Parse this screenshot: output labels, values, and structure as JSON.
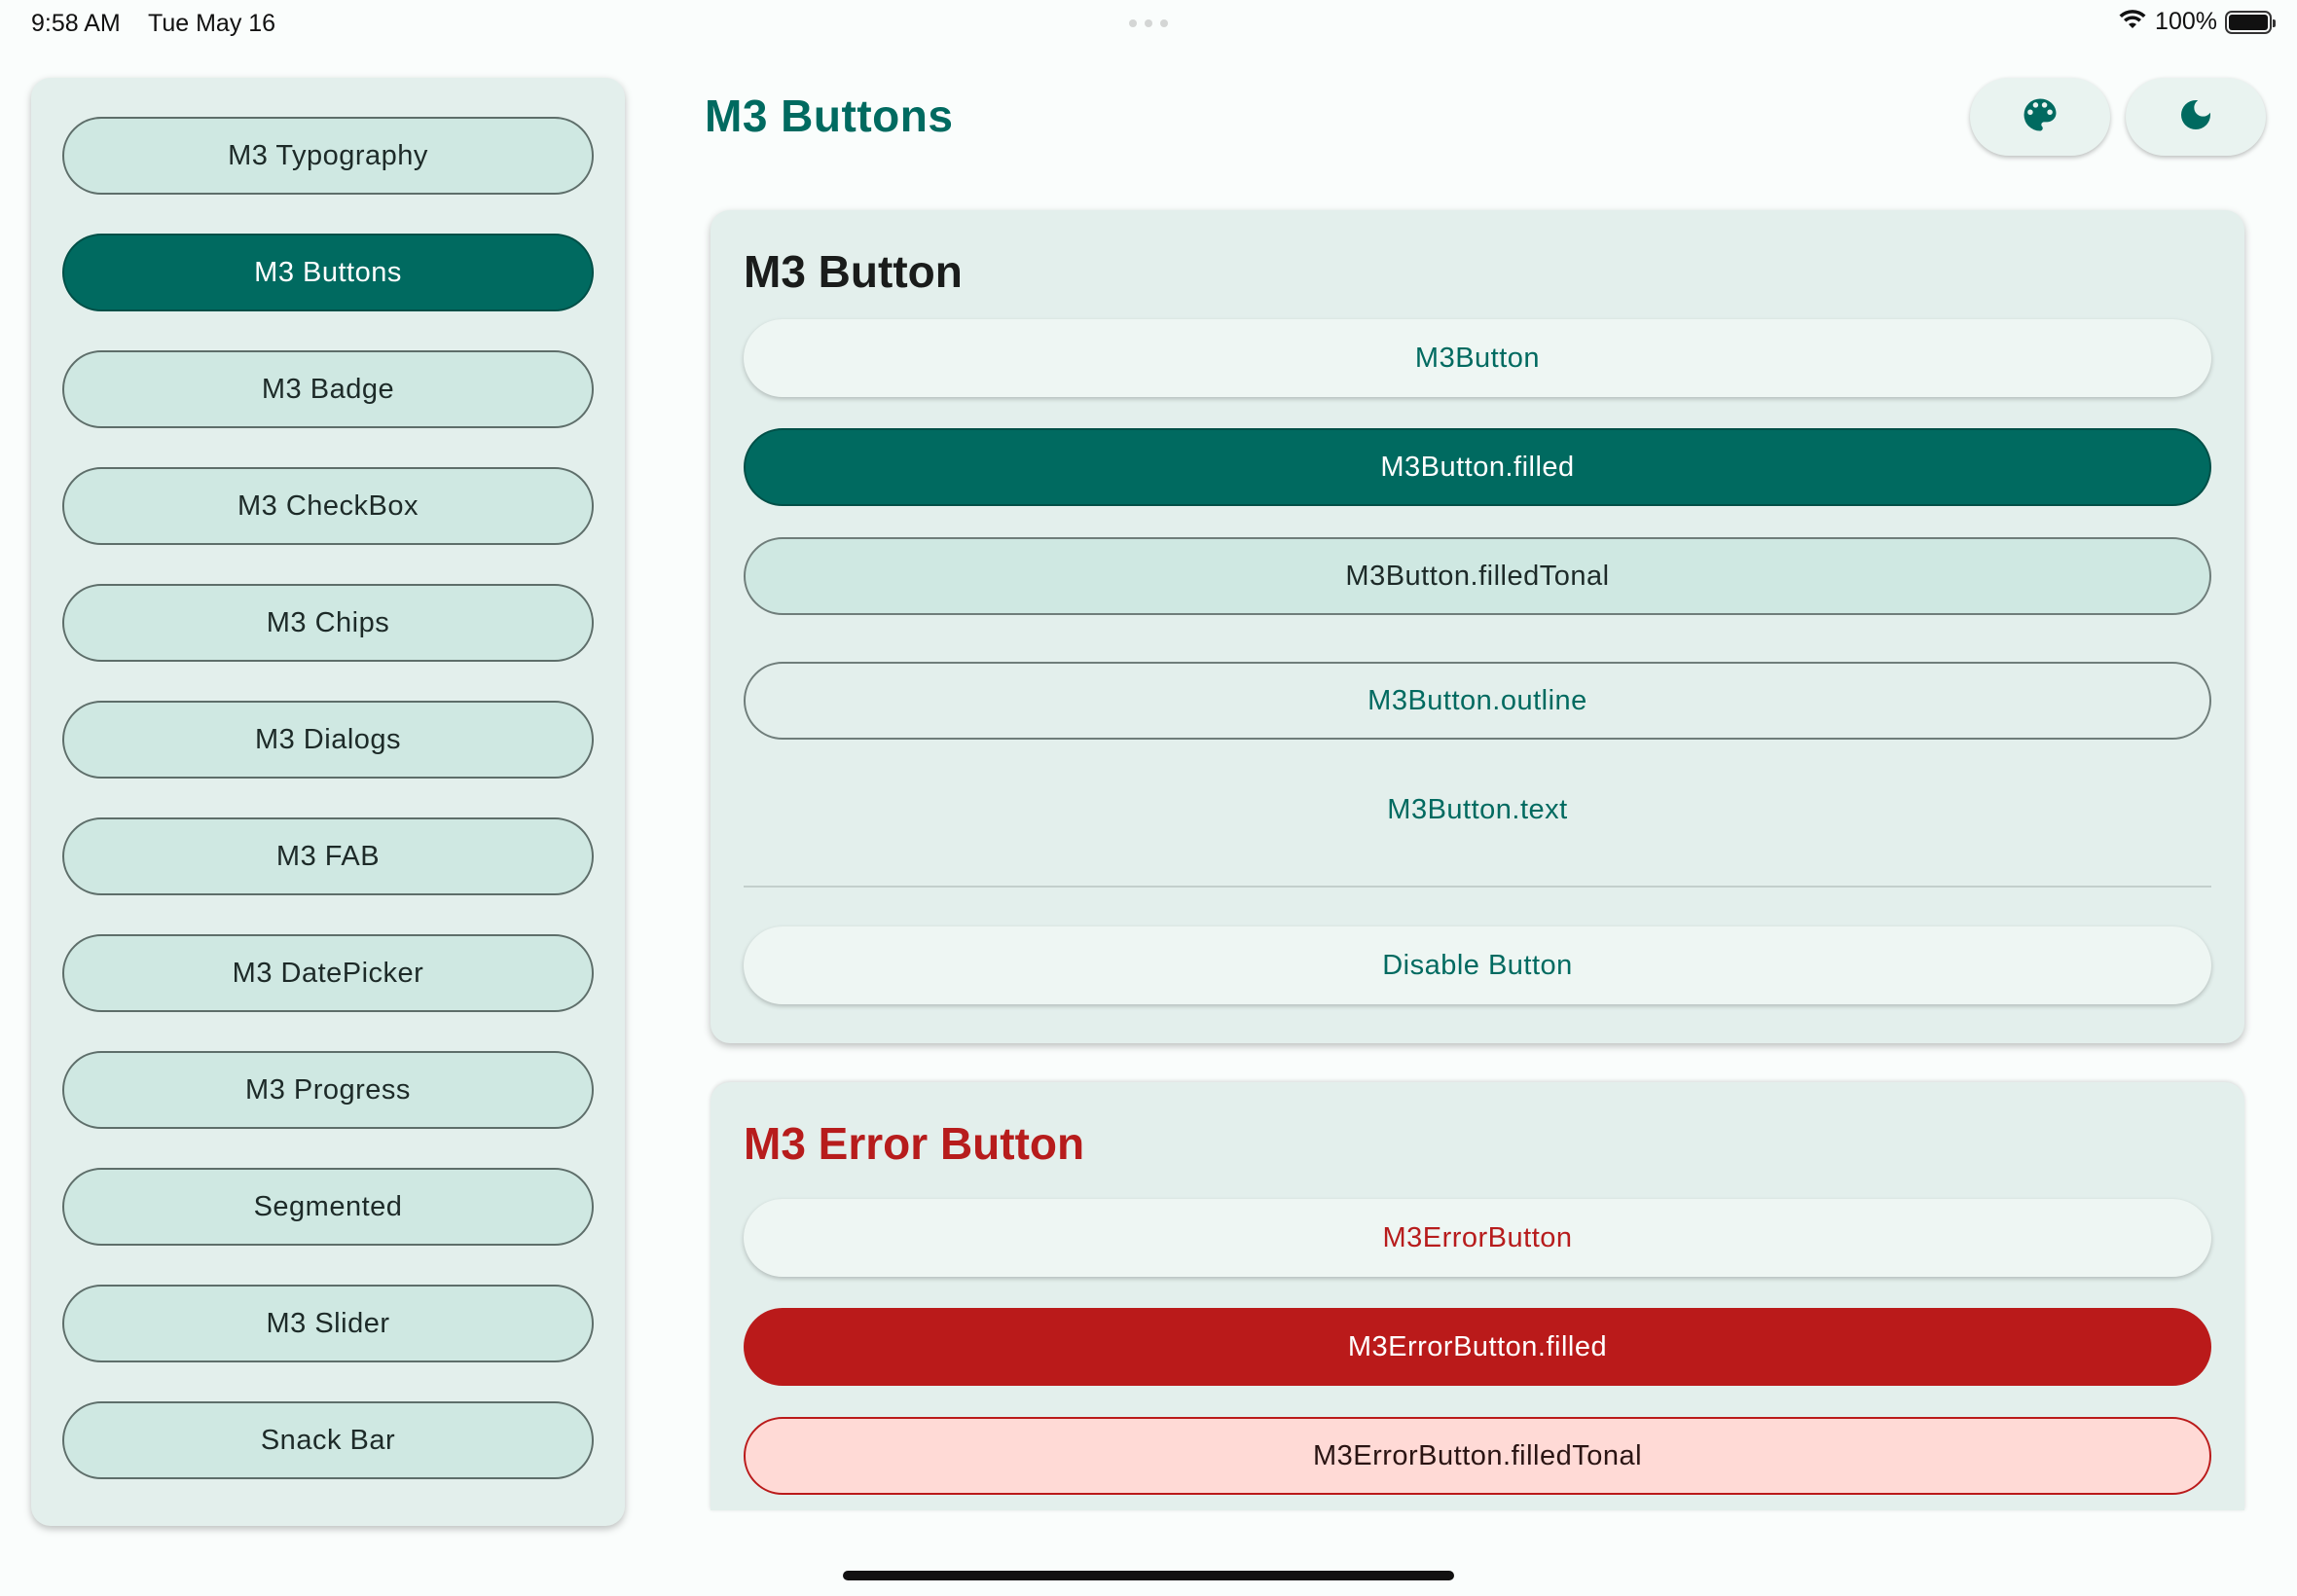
{
  "status_bar": {
    "time": "9:58 AM",
    "date": "Tue May 16",
    "battery": "100%",
    "battery_level": 1.0,
    "icons": [
      "wifi-icon",
      "battery-icon"
    ]
  },
  "sidebar": {
    "items": [
      {
        "label": "M3 Typography",
        "active": false
      },
      {
        "label": "M3 Buttons",
        "active": true
      },
      {
        "label": "M3 Badge",
        "active": false
      },
      {
        "label": "M3 CheckBox",
        "active": false
      },
      {
        "label": "M3 Chips",
        "active": false
      },
      {
        "label": "M3 Dialogs",
        "active": false
      },
      {
        "label": "M3 FAB",
        "active": false
      },
      {
        "label": "M3 DatePicker",
        "active": false
      },
      {
        "label": "M3 Progress",
        "active": false
      },
      {
        "label": "Segmented",
        "active": false
      },
      {
        "label": "M3 Slider",
        "active": false
      },
      {
        "label": "Snack Bar",
        "active": false
      }
    ]
  },
  "header": {
    "title": "M3 Buttons",
    "actions": [
      {
        "icon": "palette-icon"
      },
      {
        "icon": "dark-mode-icon"
      }
    ]
  },
  "button_card": {
    "title": "M3 Button",
    "buttons": {
      "elevated": "M3Button",
      "filled": "M3Button.filled",
      "tonal": "M3Button.filledTonal",
      "outline": "M3Button.outline",
      "text": "M3Button.text",
      "disable": "Disable Button"
    }
  },
  "error_card": {
    "title": "M3 Error Button",
    "buttons": {
      "elevated": "M3ErrorButton",
      "filled": "M3ErrorButton.filled",
      "tonal": "M3ErrorButton.filledTonal"
    }
  },
  "colors": {
    "primary": "#006a60",
    "primary_container": "#cfe8e2",
    "surface": "#e3efec",
    "error": "#ba1a1a",
    "error_container": "#ffdad6"
  }
}
